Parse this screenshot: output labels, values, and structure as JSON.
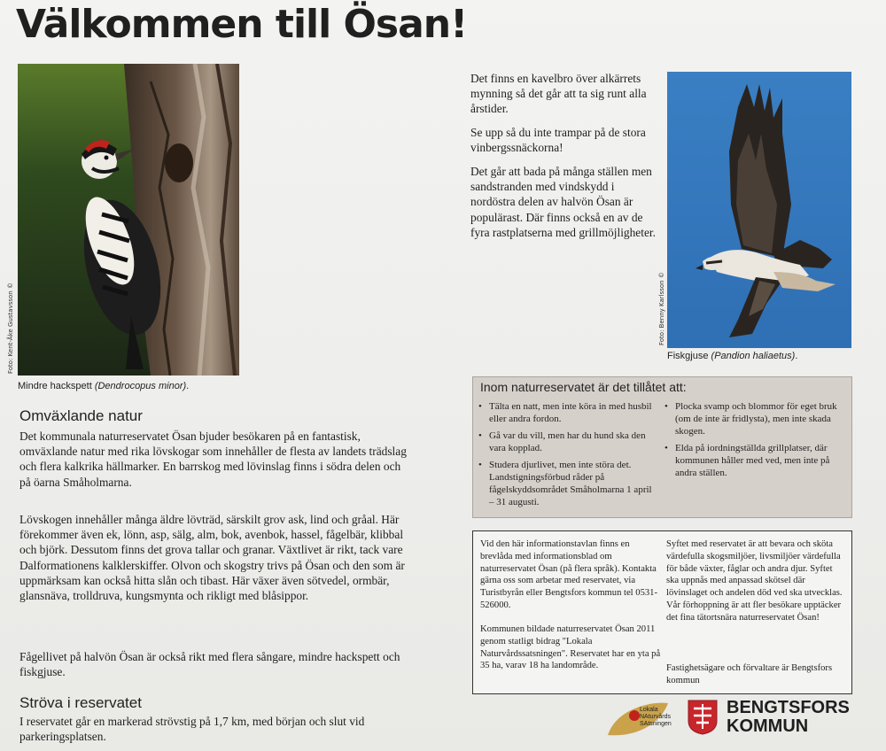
{
  "title": "Välkommen till Ösan!",
  "woodpecker": {
    "credit": "Foto: Kent-Åke Gustavsson ©",
    "caption_common": "Mindre hackspett ",
    "caption_latin": "(Dendrocopus minor)",
    "caption_end": "."
  },
  "osprey": {
    "credit": "Foto: Benny Karlsson ©",
    "caption_common": "Fiskgjuse ",
    "caption_latin": "(Pandion haliaetus)",
    "caption_end": "."
  },
  "right_paragraphs": [
    "Det finns en kavelbro över alkärrets mynning så det går att ta sig runt alla årstider.",
    "Se upp så du inte trampar på de stora vinbergssnäckorna!",
    "Det går att bada på många ställen men sandstranden med vindskydd i nordöstra delen av halvön Ösan är populärast. Där finns också en av de fyra rastplatserna med grillmöjligheter."
  ],
  "section1": {
    "heading": "Omväxlande natur",
    "paragraphs": [
      "Det kommunala naturreservatet Ösan bjuder besökaren på en fantastisk, omväxlande natur med rika lövskogar som innehåller de flesta av landets trädslag och flera kalkrika hällmarker. En barrskog med lövinslag finns i södra delen och på öarna Småholmarna.",
      "Lövskogen innehåller många äldre lövträd, särskilt grov ask, lind och gråal. Här förekommer även ek, lönn, asp, sälg, alm, bok, avenbok, hassel, fågelbär, klibbal och björk. Dessutom finns det grova tallar och granar. Växtlivet är rikt, tack vare Dalformationens kalklerskiffer. Olvon och skogstry trivs på Ösan och den som är uppmärksam kan också hitta slån och tibast. Här växer även sötvedel, ormbär, glansnäva, trolldruva, kungsmynta och rikligt med blåsippor.",
      "Fågellivet på halvön Ösan är också rikt med flera sångare, mindre hackspett och fiskgjuse."
    ]
  },
  "section2": {
    "heading": "Ströva i reservatet",
    "paragraph": "I reservatet går en markerad strövstig på 1,7 km, med början och slut vid parkeringsplatsen."
  },
  "rules": {
    "title": "Inom naturreservatet är det tillåtet att:",
    "left": [
      "Tälta en natt, men inte köra in med husbil eller andra fordon.",
      "Gå var du vill, men har du hund ska den vara kopplad.",
      "Studera djurlivet, men inte störa det. Landstigningsförbud råder på fågelskyddsområdet Småholmarna 1 april – 31 augusti."
    ],
    "right": [
      "Plocka svamp och blommor för eget bruk (om de inte är fridlysta), men inte skada skogen.",
      "Elda på iordningställda grillplatser, där kommunen håller med ved, men inte på andra ställen."
    ]
  },
  "info": {
    "left": [
      "Vid den här informationstavlan finns en brevlåda med informationsblad om naturreservatet Ösan (på flera språk). Kontakta gärna oss som arbetar med reservatet, via Turistbyrån eller Bengtsfors kommun tel 0531-526000.",
      "Kommunen bildade naturreservatet Ösan 2011 genom statligt bidrag \"Lokala Naturvårdssatsningen\". Reservatet har en yta på 35 ha, varav 18 ha landområde."
    ],
    "right": [
      "Syftet med reservatet är att bevara och sköta värdefulla skogsmiljöer, livsmiljöer värdefulla för både växter, fåglar och andra djur. Syftet ska uppnås med anpassad skötsel där lövinslaget och andelen död ved ska utvecklas. Vår förhoppning är att fler besökare upptäcker det fina tätortsnära naturreservatet Ösan!",
      "Fastighetsägare och förvaltare är Bengtsfors kommun"
    ]
  },
  "logos": {
    "lns_lines": [
      "Lokala",
      "NAturvårds",
      "SAtsningen"
    ],
    "kommun_line1": "BENGTSFORS",
    "kommun_line2": "KOMMUN"
  },
  "colors": {
    "rules_bg": "#d6d0ca",
    "sky": "#3b82c4",
    "kommun_red": "#c8262b"
  }
}
